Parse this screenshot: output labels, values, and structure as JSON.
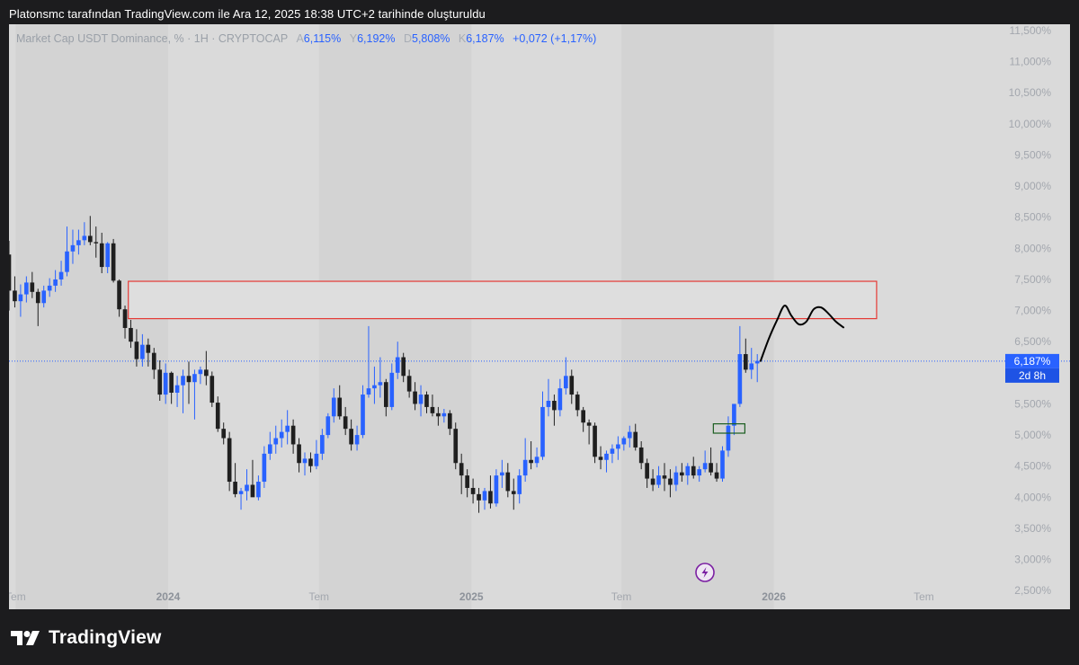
{
  "caption": "Platonsmc tarafından TradingView.com ile Ara 12, 2025 18:38 UTC+2 tarihinde oluşturuldu",
  "legend": {
    "title": "Market Cap USDT Dominance, % · 1H · CRYPTOCAP",
    "open_key": "A",
    "open": "6,115%",
    "high_key": "Y",
    "high": "6,192%",
    "low_key": "D",
    "low": "5,808%",
    "close_key": "K",
    "close": "6,187%",
    "change": "+0,072 (+1,17%)"
  },
  "price_tag": {
    "value": "6,187%",
    "countdown": "2d 8h"
  },
  "brand": "TradingView",
  "colors": {
    "up": "#2962ff",
    "down": "#1f1f1f",
    "zone_border": "#e53935",
    "tag": "#2962ff",
    "countdown_tag": "#1e53e5",
    "lightning": "#7b1fa2"
  },
  "chart_data": {
    "type": "candlestick",
    "ylim": [
      2.2,
      11.6
    ],
    "y_ticks": [
      "2,500%",
      "3,000%",
      "3,500%",
      "4,000%",
      "4,500%",
      "5,000%",
      "5,500%",
      "6,000%",
      "6,500%",
      "7,000%",
      "7,500%",
      "8,000%",
      "8,500%",
      "9,000%",
      "9,500%",
      "10,000%",
      "10,500%",
      "11,000%",
      "11,500%"
    ],
    "y_tick_values": [
      2.5,
      3.0,
      3.5,
      4.0,
      4.5,
      5.0,
      5.5,
      6.0,
      6.5,
      7.0,
      7.5,
      8.0,
      8.5,
      9.0,
      9.5,
      10.0,
      10.5,
      11.0,
      11.5
    ],
    "x_range": [
      "2023-06-23",
      "2026-10-04"
    ],
    "x_ticks": [
      {
        "date": "2023-07-01",
        "label": "Tem",
        "bold": false
      },
      {
        "date": "2024-01-01",
        "label": "2024",
        "bold": true
      },
      {
        "date": "2024-07-01",
        "label": "Tem",
        "bold": false
      },
      {
        "date": "2025-01-01",
        "label": "2025",
        "bold": true
      },
      {
        "date": "2025-07-01",
        "label": "Tem",
        "bold": false
      },
      {
        "date": "2026-01-01",
        "label": "2026",
        "bold": true
      },
      {
        "date": "2026-07-01",
        "label": "Tem",
        "bold": false
      }
    ],
    "candle_interval_days": 7,
    "first_candle": "2023-06-23",
    "candles": [
      [
        7.9,
        8.12,
        7.0,
        7.32
      ],
      [
        7.32,
        7.55,
        7.05,
        7.15
      ],
      [
        7.15,
        7.42,
        6.9,
        7.26
      ],
      [
        7.26,
        7.55,
        7.13,
        7.45
      ],
      [
        7.45,
        7.62,
        7.2,
        7.3
      ],
      [
        7.3,
        7.35,
        6.75,
        7.12
      ],
      [
        7.12,
        7.4,
        7.05,
        7.32
      ],
      [
        7.32,
        7.52,
        7.22,
        7.4
      ],
      [
        7.4,
        7.65,
        7.3,
        7.5
      ],
      [
        7.5,
        7.8,
        7.4,
        7.62
      ],
      [
        7.62,
        8.35,
        7.55,
        7.95
      ],
      [
        7.95,
        8.3,
        7.75,
        8.05
      ],
      [
        8.05,
        8.3,
        7.9,
        8.13
      ],
      [
        8.13,
        8.42,
        8.05,
        8.2
      ],
      [
        8.2,
        8.52,
        8.05,
        8.1
      ],
      [
        8.1,
        8.35,
        7.85,
        8.08
      ],
      [
        8.08,
        8.25,
        7.6,
        7.7
      ],
      [
        7.7,
        8.1,
        7.6,
        8.08
      ],
      [
        8.08,
        8.15,
        7.45,
        7.48
      ],
      [
        7.48,
        7.5,
        6.9,
        7.02
      ],
      [
        7.02,
        7.08,
        6.55,
        6.72
      ],
      [
        6.72,
        6.85,
        6.4,
        6.5
      ],
      [
        6.5,
        6.7,
        6.1,
        6.22
      ],
      [
        6.22,
        6.62,
        6.1,
        6.45
      ],
      [
        6.45,
        6.55,
        6.1,
        6.32
      ],
      [
        6.32,
        6.4,
        5.9,
        6.05
      ],
      [
        6.05,
        6.2,
        5.55,
        5.65
      ],
      [
        5.65,
        6.15,
        5.5,
        6.0
      ],
      [
        6.0,
        6.02,
        5.5,
        5.68
      ],
      [
        5.68,
        5.95,
        5.45,
        5.8
      ],
      [
        5.8,
        6.05,
        5.35,
        5.95
      ],
      [
        5.95,
        6.18,
        5.5,
        5.85
      ],
      [
        5.85,
        6.05,
        5.25,
        5.98
      ],
      [
        5.98,
        6.1,
        5.82,
        6.05
      ],
      [
        6.05,
        6.35,
        5.8,
        5.95
      ],
      [
        5.95,
        6.02,
        5.45,
        5.52
      ],
      [
        5.52,
        5.62,
        5.05,
        5.1
      ],
      [
        5.1,
        5.2,
        4.85,
        4.95
      ],
      [
        4.95,
        5.05,
        4.1,
        4.25
      ],
      [
        4.25,
        4.55,
        4.0,
        4.05
      ],
      [
        4.05,
        4.15,
        3.8,
        4.1
      ],
      [
        4.1,
        4.45,
        3.95,
        4.2
      ],
      [
        4.2,
        4.6,
        4.05,
        4.0
      ],
      [
        4.0,
        4.35,
        3.95,
        4.25
      ],
      [
        4.25,
        4.82,
        4.15,
        4.7
      ],
      [
        4.7,
        5.05,
        4.6,
        4.85
      ],
      [
        4.85,
        5.15,
        4.7,
        4.95
      ],
      [
        4.95,
        5.25,
        4.8,
        5.05
      ],
      [
        5.05,
        5.4,
        4.85,
        5.15
      ],
      [
        5.15,
        5.25,
        4.7,
        4.85
      ],
      [
        4.85,
        4.95,
        4.4,
        4.55
      ],
      [
        4.55,
        4.72,
        4.35,
        4.62
      ],
      [
        4.62,
        4.72,
        4.4,
        4.5
      ],
      [
        4.5,
        4.92,
        4.45,
        4.7
      ],
      [
        4.7,
        5.1,
        4.6,
        5.0
      ],
      [
        5.0,
        5.35,
        4.95,
        5.3
      ],
      [
        5.3,
        5.75,
        5.2,
        5.6
      ],
      [
        5.6,
        5.8,
        5.25,
        5.3
      ],
      [
        5.3,
        5.45,
        5.0,
        5.1
      ],
      [
        5.1,
        5.25,
        4.75,
        4.85
      ],
      [
        4.85,
        5.15,
        4.75,
        5.0
      ],
      [
        5.0,
        5.8,
        4.95,
        5.65
      ],
      [
        5.65,
        6.75,
        5.6,
        5.75
      ],
      [
        5.75,
        6.1,
        5.5,
        5.8
      ],
      [
        5.8,
        6.25,
        5.6,
        5.85
      ],
      [
        5.85,
        5.9,
        5.3,
        5.45
      ],
      [
        5.45,
        6.15,
        5.4,
        6.0
      ],
      [
        6.0,
        6.5,
        5.9,
        6.25
      ],
      [
        6.25,
        6.32,
        5.85,
        5.95
      ],
      [
        5.95,
        6.05,
        5.6,
        5.7
      ],
      [
        5.7,
        5.85,
        5.4,
        5.5
      ],
      [
        5.5,
        5.8,
        5.3,
        5.65
      ],
      [
        5.65,
        5.7,
        5.35,
        5.45
      ],
      [
        5.45,
        5.65,
        5.3,
        5.35
      ],
      [
        5.35,
        5.45,
        5.15,
        5.3
      ],
      [
        5.3,
        5.42,
        5.2,
        5.35
      ],
      [
        5.35,
        5.4,
        5.0,
        5.1
      ],
      [
        5.1,
        5.2,
        4.45,
        4.55
      ],
      [
        4.55,
        4.7,
        4.05,
        4.35
      ],
      [
        4.35,
        4.45,
        4.0,
        4.15
      ],
      [
        4.15,
        4.3,
        3.9,
        4.05
      ],
      [
        4.05,
        4.15,
        3.75,
        3.95
      ],
      [
        3.95,
        4.15,
        3.8,
        4.1
      ],
      [
        4.1,
        4.35,
        3.82,
        3.9
      ],
      [
        3.9,
        4.45,
        3.85,
        4.35
      ],
      [
        4.35,
        4.6,
        4.15,
        4.4
      ],
      [
        4.4,
        4.55,
        4.0,
        4.1
      ],
      [
        4.1,
        4.3,
        3.8,
        4.05
      ],
      [
        4.05,
        4.45,
        3.9,
        4.35
      ],
      [
        4.35,
        4.95,
        4.25,
        4.6
      ],
      [
        4.6,
        4.9,
        4.45,
        4.55
      ],
      [
        4.55,
        4.8,
        4.48,
        4.65
      ],
      [
        4.65,
        5.7,
        4.6,
        5.45
      ],
      [
        5.45,
        5.9,
        5.3,
        5.55
      ],
      [
        5.55,
        5.65,
        5.15,
        5.4
      ],
      [
        5.4,
        5.9,
        5.3,
        5.75
      ],
      [
        5.75,
        6.25,
        5.65,
        5.95
      ],
      [
        5.95,
        6.05,
        5.5,
        5.65
      ],
      [
        5.65,
        5.7,
        5.3,
        5.4
      ],
      [
        5.4,
        5.45,
        5.05,
        5.2
      ],
      [
        5.2,
        5.25,
        4.85,
        5.15
      ],
      [
        5.15,
        5.2,
        4.55,
        4.65
      ],
      [
        4.65,
        4.82,
        4.45,
        4.6
      ],
      [
        4.6,
        4.75,
        4.4,
        4.7
      ],
      [
        4.7,
        4.85,
        4.55,
        4.78
      ],
      [
        4.78,
        4.98,
        4.6,
        4.85
      ],
      [
        4.85,
        4.98,
        4.75,
        4.95
      ],
      [
        4.95,
        5.15,
        4.8,
        5.05
      ],
      [
        5.05,
        5.18,
        4.75,
        4.8
      ],
      [
        4.8,
        4.9,
        4.45,
        4.55
      ],
      [
        4.55,
        4.62,
        4.15,
        4.3
      ],
      [
        4.3,
        4.45,
        4.1,
        4.2
      ],
      [
        4.2,
        4.5,
        4.15,
        4.35
      ],
      [
        4.35,
        4.55,
        4.1,
        4.3
      ],
      [
        4.3,
        4.45,
        4.0,
        4.2
      ],
      [
        4.2,
        4.5,
        4.1,
        4.4
      ],
      [
        4.4,
        4.55,
        4.25,
        4.35
      ],
      [
        4.35,
        4.55,
        4.2,
        4.5
      ],
      [
        4.5,
        4.65,
        4.3,
        4.35
      ],
      [
        4.35,
        4.5,
        4.25,
        4.45
      ],
      [
        4.45,
        4.75,
        4.4,
        4.55
      ],
      [
        4.55,
        4.8,
        4.35,
        4.4
      ],
      [
        4.4,
        4.55,
        4.25,
        4.3
      ],
      [
        4.3,
        4.82,
        4.25,
        4.75
      ],
      [
        4.75,
        5.3,
        4.65,
        5.15
      ],
      [
        5.15,
        5.5,
        5.0,
        5.5
      ],
      [
        5.5,
        6.75,
        5.45,
        6.3
      ],
      [
        6.3,
        6.55,
        6.0,
        6.05
      ],
      [
        6.05,
        6.4,
        5.9,
        6.15
      ],
      [
        6.15,
        6.3,
        5.85,
        6.19
      ]
    ],
    "resistance_zone": {
      "y_bottom": 6.87,
      "y_top": 7.47,
      "x_start": "2023-11-14",
      "x_end": "2026-05-05"
    },
    "demand_box": {
      "y_bottom": 5.03,
      "y_top": 5.18,
      "x_start": "2025-10-20",
      "x_end": "2025-11-27"
    },
    "current_price": 6.187,
    "projection_path": [
      [
        "2025-12-16",
        6.19
      ],
      [
        "2025-12-26",
        6.55
      ],
      [
        "2026-01-05",
        6.85
      ],
      [
        "2026-01-14",
        7.08
      ],
      [
        "2026-01-22",
        6.92
      ],
      [
        "2026-01-31",
        6.78
      ],
      [
        "2026-02-09",
        6.82
      ],
      [
        "2026-02-18",
        7.02
      ],
      [
        "2026-02-27",
        7.05
      ],
      [
        "2026-03-08",
        6.95
      ],
      [
        "2026-03-17",
        6.82
      ],
      [
        "2026-03-26",
        6.73
      ]
    ]
  }
}
